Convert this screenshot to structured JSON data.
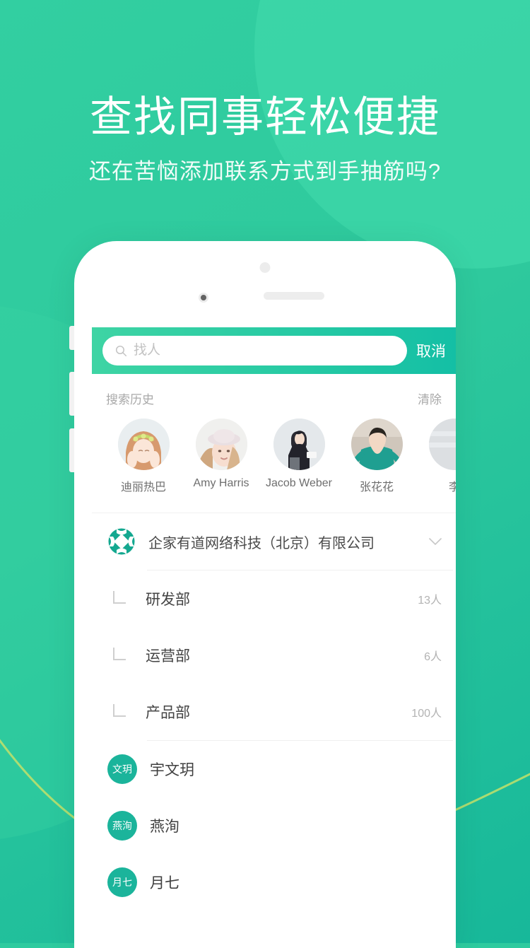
{
  "hero": {
    "title": "查找同事轻松便捷",
    "subtitle": "还在苦恼添加联系方式到手抽筋吗?"
  },
  "colors": {
    "brand_green": "#2ec99d",
    "header_gradient_start": "#3ed4a4",
    "header_gradient_end": "#14bfa5",
    "avatar_teal": "#1bb49b",
    "accent_line": "#c3e06a"
  },
  "search": {
    "icon": "search-icon",
    "placeholder": "找人",
    "value": "",
    "cancel_label": "取消"
  },
  "history": {
    "title": "搜索历史",
    "clear_label": "清除",
    "people": [
      {
        "name": "迪丽热巴",
        "photo": "woman-flower-crown"
      },
      {
        "name": "Amy Harris",
        "photo": "woman-hat"
      },
      {
        "name": "Jacob Weber",
        "photo": "man-standing"
      },
      {
        "name": "张花花",
        "photo": "man-teal-sweater"
      },
      {
        "name": "李",
        "photo": "partial-avatar"
      }
    ]
  },
  "organization": {
    "company_name": "企家有道网络科技（北京）有限公司",
    "logo_icon": "company-gear-logo-icon",
    "expand_icon": "chevron-down-icon",
    "departments": [
      {
        "name": "研发部",
        "count": "13人"
      },
      {
        "name": "运营部",
        "count": "6人"
      },
      {
        "name": "产品部",
        "count": "100人"
      }
    ]
  },
  "contacts": [
    {
      "initials": "文玥",
      "name": "宇文玥"
    },
    {
      "initials": "燕洵",
      "name": "燕洵"
    },
    {
      "initials": "月七",
      "name": "月七"
    }
  ]
}
